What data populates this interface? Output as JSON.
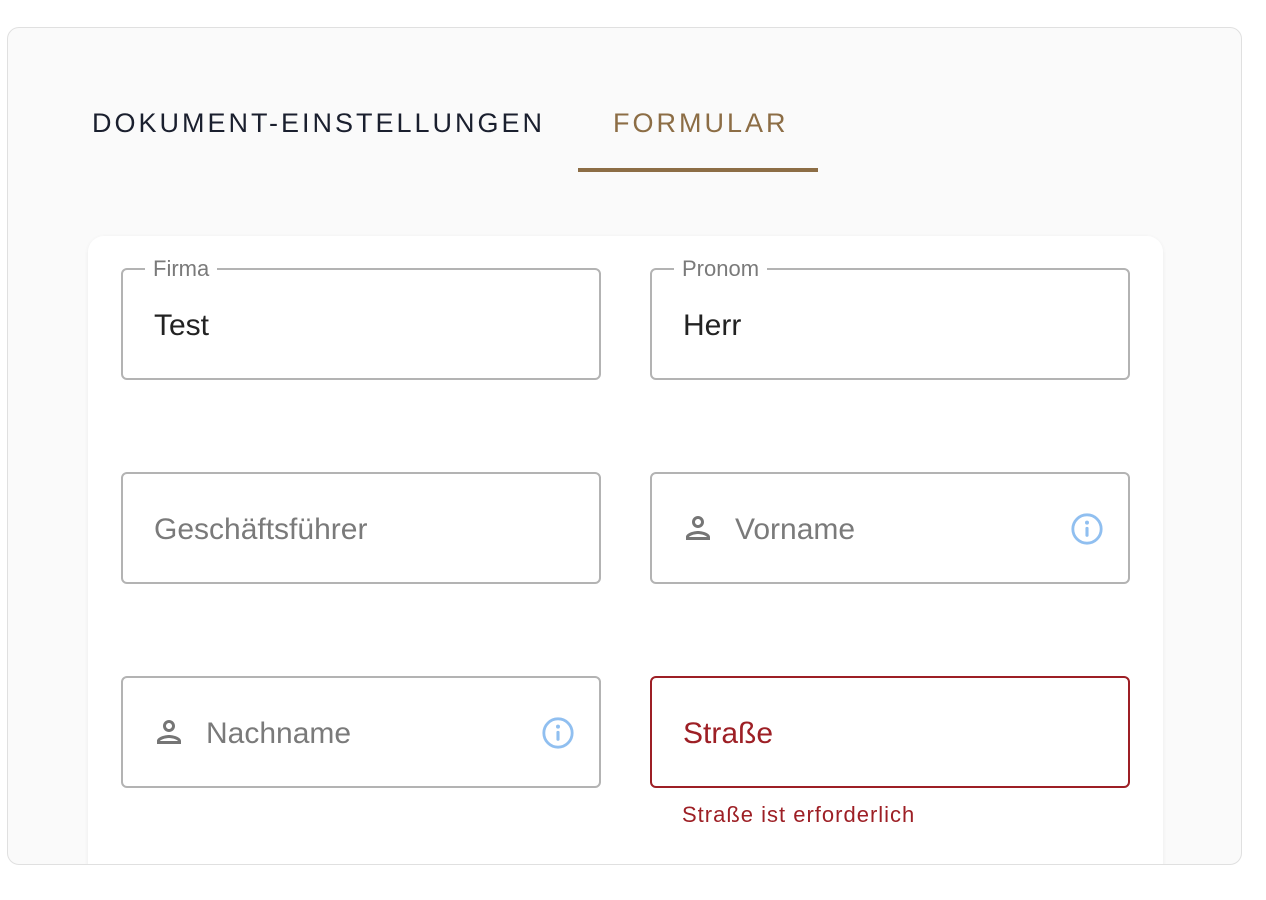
{
  "tabs": [
    {
      "label": "DOKUMENT-EINSTELLUNGEN",
      "active": false
    },
    {
      "label": "FORMULAR",
      "active": true
    }
  ],
  "form": {
    "firma": {
      "label": "Firma",
      "value": "Test"
    },
    "pronom": {
      "label": "Pronom",
      "value": "Herr"
    },
    "geschaeftsfuehrer": {
      "placeholder": "Geschäftsführer"
    },
    "vorname": {
      "placeholder": "Vorname",
      "leading_icon": "person-icon",
      "trailing_icon": "info-icon"
    },
    "nachname": {
      "placeholder": "Nachname",
      "leading_icon": "person-icon",
      "trailing_icon": "info-icon"
    },
    "strasse": {
      "placeholder": "Straße",
      "error": "Straße ist erforderlich"
    }
  },
  "colors": {
    "accent": "#8c6d45",
    "error": "#9d1f25",
    "info_icon": "#90bff0",
    "tab_inactive": "#1a1f2e"
  }
}
